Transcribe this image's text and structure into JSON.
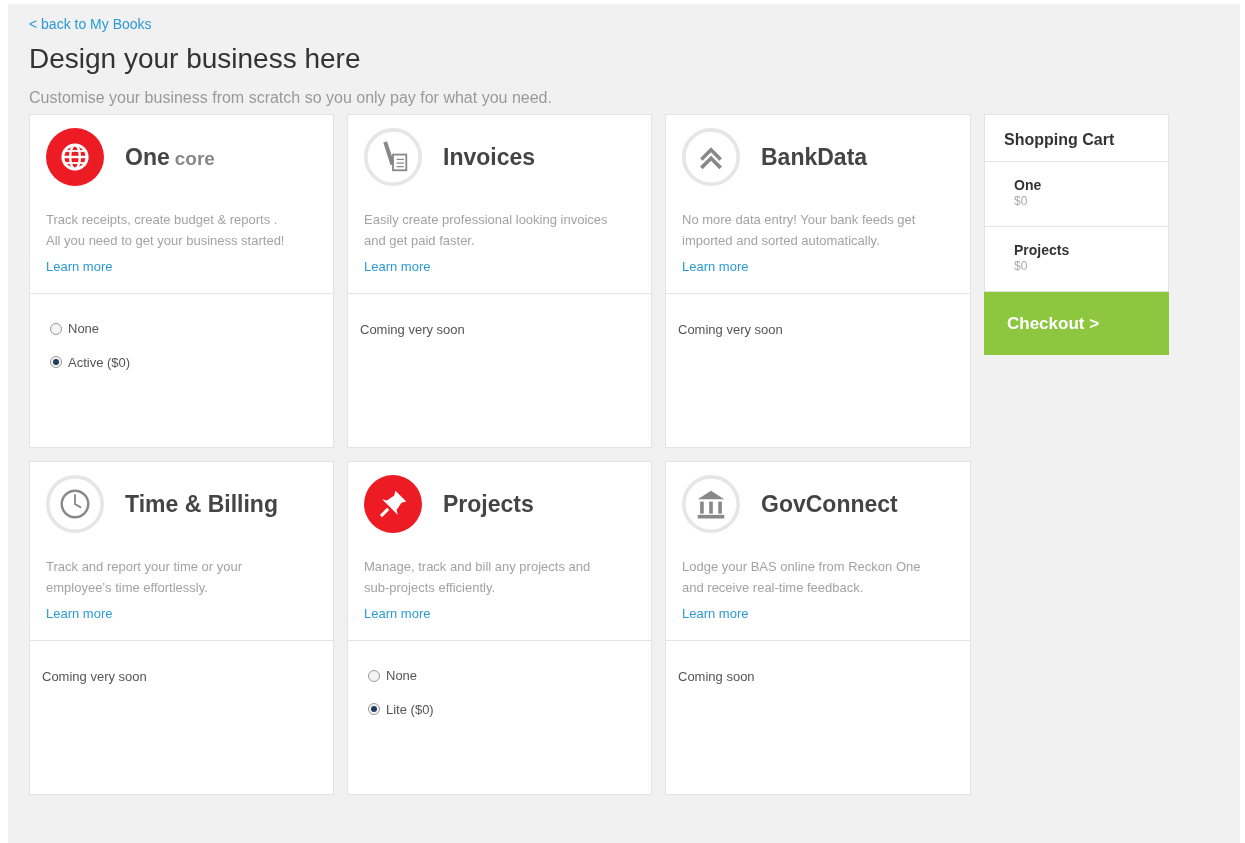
{
  "back_link": "< back to My Books",
  "heading": "Design your business here",
  "subheading": "Customise your business from scratch so you only pay for what you need.",
  "modules": [
    {
      "kind": "globe",
      "highlighted": true,
      "title": "One",
      "title_suffix": "core",
      "description": "Track receipts, create budget & reports .\nAll you need to get your business started!",
      "link": "Learn more",
      "footer": {
        "kind": "options",
        "options": [
          {
            "label": "None",
            "selected": false
          },
          {
            "label": "Active ($0)",
            "selected": true
          }
        ]
      }
    },
    {
      "kind": "pen",
      "highlighted": false,
      "title": "Invoices",
      "description": "Easily create professional looking invoices\nand get paid faster.",
      "link": "Learn more",
      "footer": {
        "kind": "note",
        "text": "Coming very soon"
      }
    },
    {
      "kind": "chevrons",
      "highlighted": false,
      "title": "BankData",
      "description": "No more data entry! Your bank feeds get\nimported and sorted automatically.",
      "link": "Learn more",
      "footer": {
        "kind": "note",
        "text": "Coming very soon"
      }
    },
    {
      "kind": "clock",
      "highlighted": false,
      "title": "Time & Billing",
      "description": "Track and report your time or your\nemployee’s time effortlessly.",
      "link": "Learn more",
      "footer": {
        "kind": "note",
        "text": "Coming very soon"
      }
    },
    {
      "kind": "pin",
      "highlighted": true,
      "title": "Projects",
      "description": "Manage, track and bill any projects and\nsub-projects efficiently.",
      "link": "Learn more",
      "footer": {
        "kind": "options",
        "options": [
          {
            "label": "None",
            "selected": false
          },
          {
            "label": "Lite ($0)",
            "selected": true
          }
        ]
      }
    },
    {
      "kind": "bank",
      "highlighted": false,
      "title": "GovConnect",
      "description": "Lodge your BAS online from Reckon One\nand receive real-time feedback.",
      "link": "Learn more",
      "footer": {
        "kind": "note",
        "text": "Coming soon"
      }
    }
  ],
  "cart": {
    "title": "Shopping Cart",
    "items": [
      {
        "name": "One",
        "price": "$0"
      },
      {
        "name": "Projects",
        "price": "$0"
      }
    ],
    "checkout": "Checkout >"
  }
}
